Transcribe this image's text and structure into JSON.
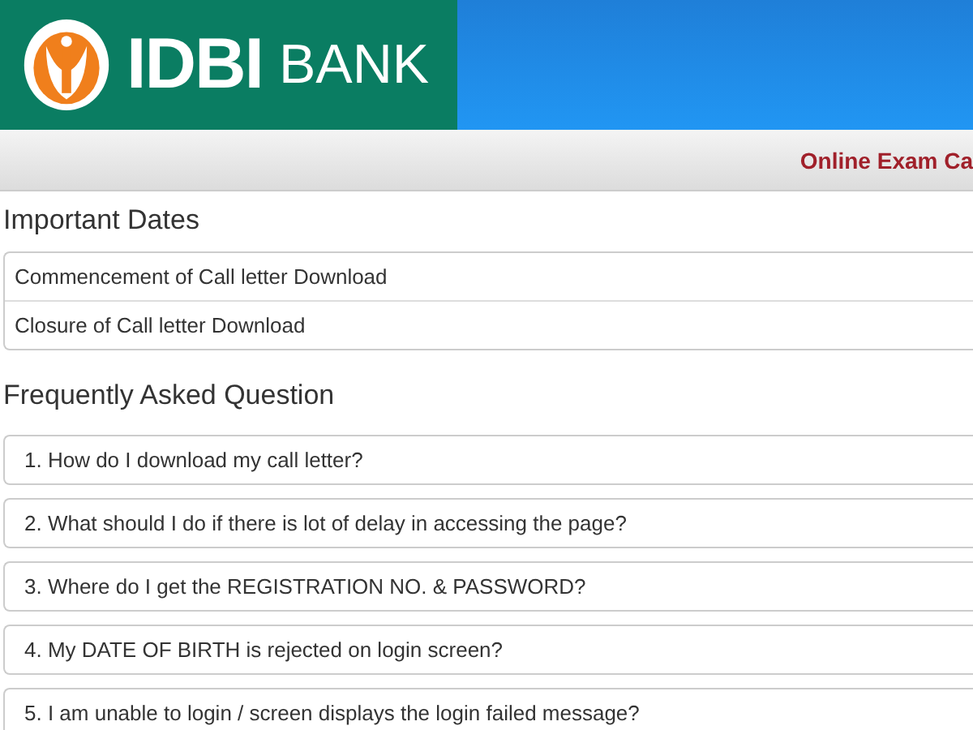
{
  "header": {
    "logo": {
      "name": "IDBI",
      "suffix": "BANK"
    }
  },
  "nav_bar": {
    "title": "Online Exam Ca"
  },
  "important_dates": {
    "heading": "Important Dates",
    "rows": [
      "Commencement of Call letter Download",
      "Closure of Call letter Download"
    ]
  },
  "faq": {
    "heading": "Frequently Asked Question",
    "items": [
      "1. How do I download my call letter?",
      "2. What should I do if there is lot of delay in accessing the page?",
      "3. Where do I get the REGISTRATION NO. & PASSWORD?",
      "4. My DATE OF BIRTH is rejected on login screen?",
      "5. I am unable to login / screen displays the login failed message?"
    ]
  }
}
